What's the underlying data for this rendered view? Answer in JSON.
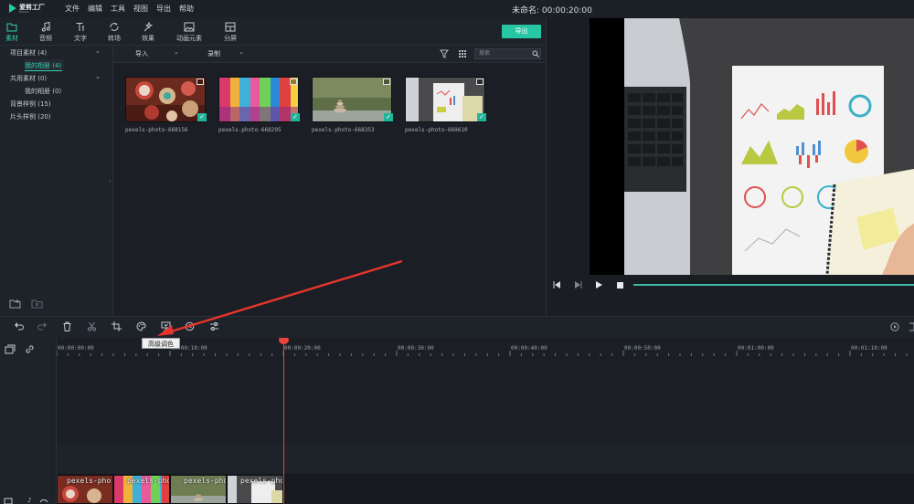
{
  "app": {
    "logo_text": "爱剪工厂",
    "logo_sub": "filmora",
    "menu": [
      "文件",
      "编辑",
      "工具",
      "视图",
      "导出",
      "帮助"
    ],
    "project_title": "未命名: 00:00:20:00"
  },
  "tabs": [
    {
      "label": "素材",
      "icon": "folder-icon",
      "active": true
    },
    {
      "label": "音频",
      "icon": "music-note-icon",
      "active": false
    },
    {
      "label": "文字",
      "icon": "text-icon",
      "active": false
    },
    {
      "label": "转场",
      "icon": "transition-icon",
      "active": false
    },
    {
      "label": "效果",
      "icon": "effects-icon",
      "active": false
    },
    {
      "label": "动画元素",
      "icon": "image-icon",
      "active": false
    },
    {
      "label": "分屏",
      "icon": "split-screen-icon",
      "active": false
    }
  ],
  "export_label": "导出",
  "sidebar": {
    "items": [
      {
        "label": "项目素材 (4)",
        "expandable": true
      },
      {
        "label": "我的相册 (4)",
        "selected": true
      },
      {
        "label": "共用素材 (0)",
        "expandable": true
      },
      {
        "label": "我的相册 (0)"
      },
      {
        "label": "背景样例 (15)"
      },
      {
        "label": "片头样例 (20)"
      }
    ]
  },
  "media_toolbar": {
    "import_label": "导入",
    "record_label": "录制",
    "search_placeholder": "搜索"
  },
  "media": [
    {
      "label": "pexels-photo-668156",
      "icon": "image-icon"
    },
    {
      "label": "pexels-photo-668295",
      "icon": "image-icon"
    },
    {
      "label": "pexels-photo-668353",
      "icon": "image-icon"
    },
    {
      "label": "pexels-photo-669610",
      "icon": "image-icon"
    }
  ],
  "tooltip": "高级调色",
  "ruler": [
    "00:00:00:00",
    "00:00:10:00",
    "00:00:20:00",
    "00:00:30:00",
    "00:00:40:00",
    "00:00:50:00",
    "00:01:00:00",
    "00:01:10:00"
  ],
  "clips": [
    "pexels-pho",
    "pexels-pho",
    "pexels-pho",
    "pexels-pho"
  ],
  "colors": {
    "accent": "#27c6a4",
    "playhead": "#e8443a"
  }
}
